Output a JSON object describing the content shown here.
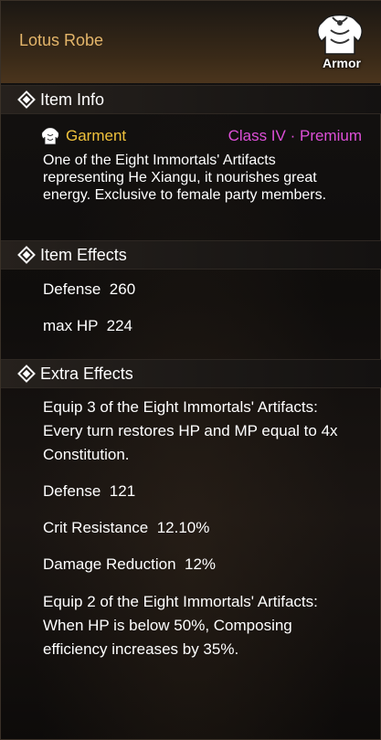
{
  "item": {
    "name": "Lotus Robe",
    "type_label": "Armor",
    "type_icon": "armor-icon"
  },
  "item_info": {
    "title": "Item Info",
    "category": "Garment",
    "category_icon": "garment-icon",
    "grade": "Class IV · Premium",
    "description": "One of the Eight Immortals' Artifacts representing He Xiangu, it nourishes great energy. Exclusive to female party members."
  },
  "item_effects": {
    "title": "Item Effects",
    "stats": [
      {
        "name": "Defense",
        "value": "260"
      },
      {
        "name": "max HP",
        "value": "224"
      }
    ]
  },
  "extra_effects": {
    "title": "Extra Effects",
    "set_bonus_3": "Equip 3 of the Eight Immortals' Artifacts: Every turn restores HP and MP equal to 4x Constitution.",
    "stats": [
      {
        "name": "Defense",
        "value": "121"
      },
      {
        "name": "Crit Resistance",
        "value": "12.10%"
      },
      {
        "name": "Damage Reduction",
        "value": "12%"
      }
    ],
    "set_bonus_2": "Equip 2 of the Eight Immortals' Artifacts: When HP is below 50%, Composing efficiency increases by 35%."
  },
  "colors": {
    "item_name": "#e3b56a",
    "category": "#f0c23c",
    "grade": "#de4fd8",
    "text": "#ffffff"
  }
}
